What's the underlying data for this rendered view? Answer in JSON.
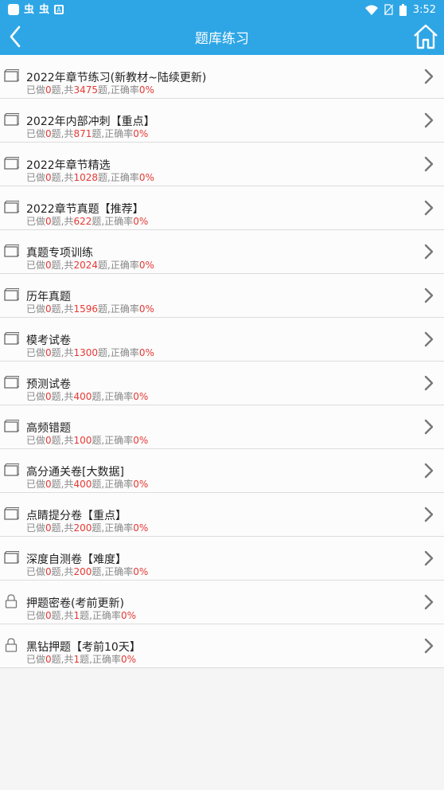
{
  "status_bar": {
    "left_glyphs": [
      "虫",
      "虫"
    ],
    "badge": "A",
    "battery_glyph": "1",
    "time": "3:52"
  },
  "header": {
    "title": "题库练习",
    "back_icon": "chevron-left-icon",
    "home_icon": "home-icon"
  },
  "colors": {
    "accent": "#2ea6e6",
    "highlight": "#e53935"
  },
  "stat_words": {
    "done_prefix": "已做",
    "done_suffix": "题,共",
    "total_suffix": "题,正确率"
  },
  "items": [
    {
      "title": "2022年章节练习(新教材~陆续更新)",
      "done": "0",
      "total": "3475",
      "accuracy": "0%",
      "icon": "book-icon"
    },
    {
      "title": "2022年内部冲刺【重点】",
      "done": "0",
      "total": "871",
      "accuracy": "0%",
      "icon": "book-icon"
    },
    {
      "title": "2022年章节精选",
      "done": "0",
      "total": "1028",
      "accuracy": "0%",
      "icon": "book-icon"
    },
    {
      "title": "2022章节真题【推荐】",
      "done": "0",
      "total": "622",
      "accuracy": "0%",
      "icon": "book-icon"
    },
    {
      "title": "真题专项训练",
      "done": "0",
      "total": "2024",
      "accuracy": "0%",
      "icon": "book-icon"
    },
    {
      "title": "历年真题",
      "done": "0",
      "total": "1596",
      "accuracy": "0%",
      "icon": "book-icon"
    },
    {
      "title": "模考试卷",
      "done": "0",
      "total": "1300",
      "accuracy": "0%",
      "icon": "book-icon"
    },
    {
      "title": "预测试卷",
      "done": "0",
      "total": "400",
      "accuracy": "0%",
      "icon": "book-icon"
    },
    {
      "title": "高频错题",
      "done": "0",
      "total": "100",
      "accuracy": "0%",
      "icon": "book-icon"
    },
    {
      "title": "高分通关卷[大数据]",
      "done": "0",
      "total": "400",
      "accuracy": "0%",
      "icon": "book-icon"
    },
    {
      "title": "点睛提分卷【重点】",
      "done": "0",
      "total": "200",
      "accuracy": "0%",
      "icon": "book-icon"
    },
    {
      "title": "深度自测卷【难度】",
      "done": "0",
      "total": "200",
      "accuracy": "0%",
      "icon": "book-icon"
    },
    {
      "title": "押题密卷(考前更新)",
      "done": "0",
      "total": "1",
      "accuracy": "0%",
      "icon": "lock-icon"
    },
    {
      "title": "黑钻押题【考前10天】",
      "done": "0",
      "total": "1",
      "accuracy": "0%",
      "icon": "lock-icon"
    }
  ]
}
